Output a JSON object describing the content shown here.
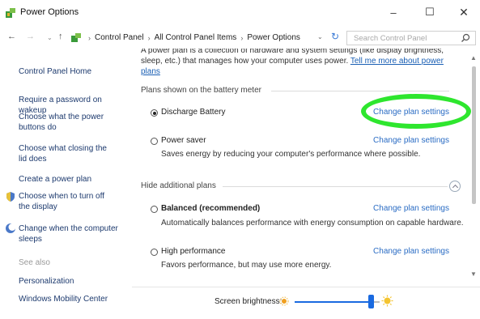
{
  "window": {
    "title": "Power Options",
    "minimize_glyph": "–",
    "maximize_glyph": "☐",
    "close_glyph": "✕"
  },
  "address": {
    "back_glyph": "←",
    "forward_glyph": "→",
    "recent_glyph": "⌄",
    "up_glyph": "↑",
    "breadcrumb": [
      "Control Panel",
      "All Control Panel Items",
      "Power Options"
    ],
    "separator": "›",
    "dropdown_glyph": "⌄",
    "refresh_glyph": "↻",
    "search_placeholder": "Search Control Panel"
  },
  "sidebar": {
    "home": "Control Panel Home",
    "items": [
      "Require a password on wakeup",
      "Choose what the power buttons do",
      "Choose what closing the lid does",
      "Create a power plan",
      "Choose when to turn off the display",
      "Change when the computer sleeps"
    ],
    "see_also_label": "See also",
    "see_also": [
      "Personalization",
      "Windows Mobility Center"
    ]
  },
  "main": {
    "intro_text": "A power plan is a collection of hardware and system settings (like display brightness, sleep, etc.) that manages how your computer uses power.",
    "intro_link": "Tell me more about power plans",
    "battery_meter_label": "Plans shown on the battery meter",
    "hide_additional_label": "Hide additional plans",
    "change_link": "Change plan settings",
    "plans": [
      {
        "name": "Discharge Battery",
        "selected": true,
        "description": ""
      },
      {
        "name": "Power saver",
        "selected": false,
        "description": "Saves energy by reducing your computer's performance where possible."
      },
      {
        "name": "Balanced (recommended)",
        "selected": false,
        "description": "Automatically balances performance with energy consumption on capable hardware."
      },
      {
        "name": "High performance",
        "selected": false,
        "description": "Favors performance, but may use more energy."
      }
    ]
  },
  "scrollbar": {
    "up_glyph": "▲",
    "down_glyph": "▼"
  },
  "brightness": {
    "label": "Screen brightness:",
    "level_fraction": 0.9
  },
  "colors": {
    "link": "#2a6cc4",
    "highlight_ring": "#2ee62e",
    "slider_accent": "#1a6ae0"
  },
  "icons": [
    "power-options-icon",
    "search-icon",
    "shield-icon",
    "moon-icon",
    "sun-small-icon",
    "sun-large-icon"
  ]
}
